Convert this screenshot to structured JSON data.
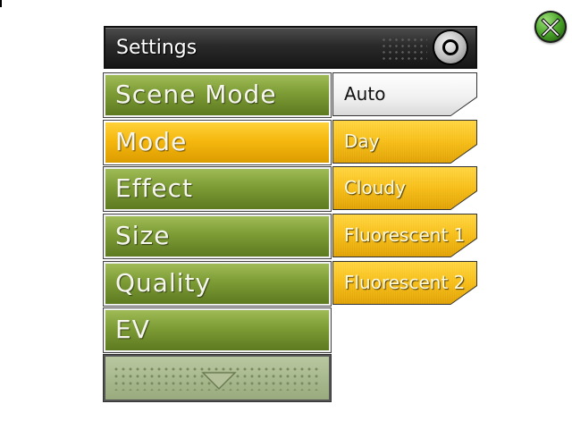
{
  "header": {
    "title": "Settings"
  },
  "menu": {
    "items": [
      {
        "label": "Scene Mode"
      },
      {
        "label": "Mode"
      },
      {
        "label": "Effect"
      },
      {
        "label": "Size"
      },
      {
        "label": "Quality"
      },
      {
        "label": "EV"
      }
    ],
    "selected_label": "Mode"
  },
  "options": {
    "items": [
      {
        "label": "Auto"
      },
      {
        "label": "Day"
      },
      {
        "label": "Cloudy"
      },
      {
        "label": "Fluorescent 1"
      },
      {
        "label": "Fluorescent 2"
      }
    ],
    "selected_label": "Auto"
  },
  "icons": {
    "close": "close-x-icon",
    "knob": "dial-knob-icon",
    "scroll": "triangle-down-icon"
  },
  "colors": {
    "menu_green": "#7d9c35",
    "selected_yellow": "#f5b80f",
    "header_dark": "#2a2a2a",
    "option_white": "#f0f0f0",
    "close_green": "#4aa62a"
  }
}
